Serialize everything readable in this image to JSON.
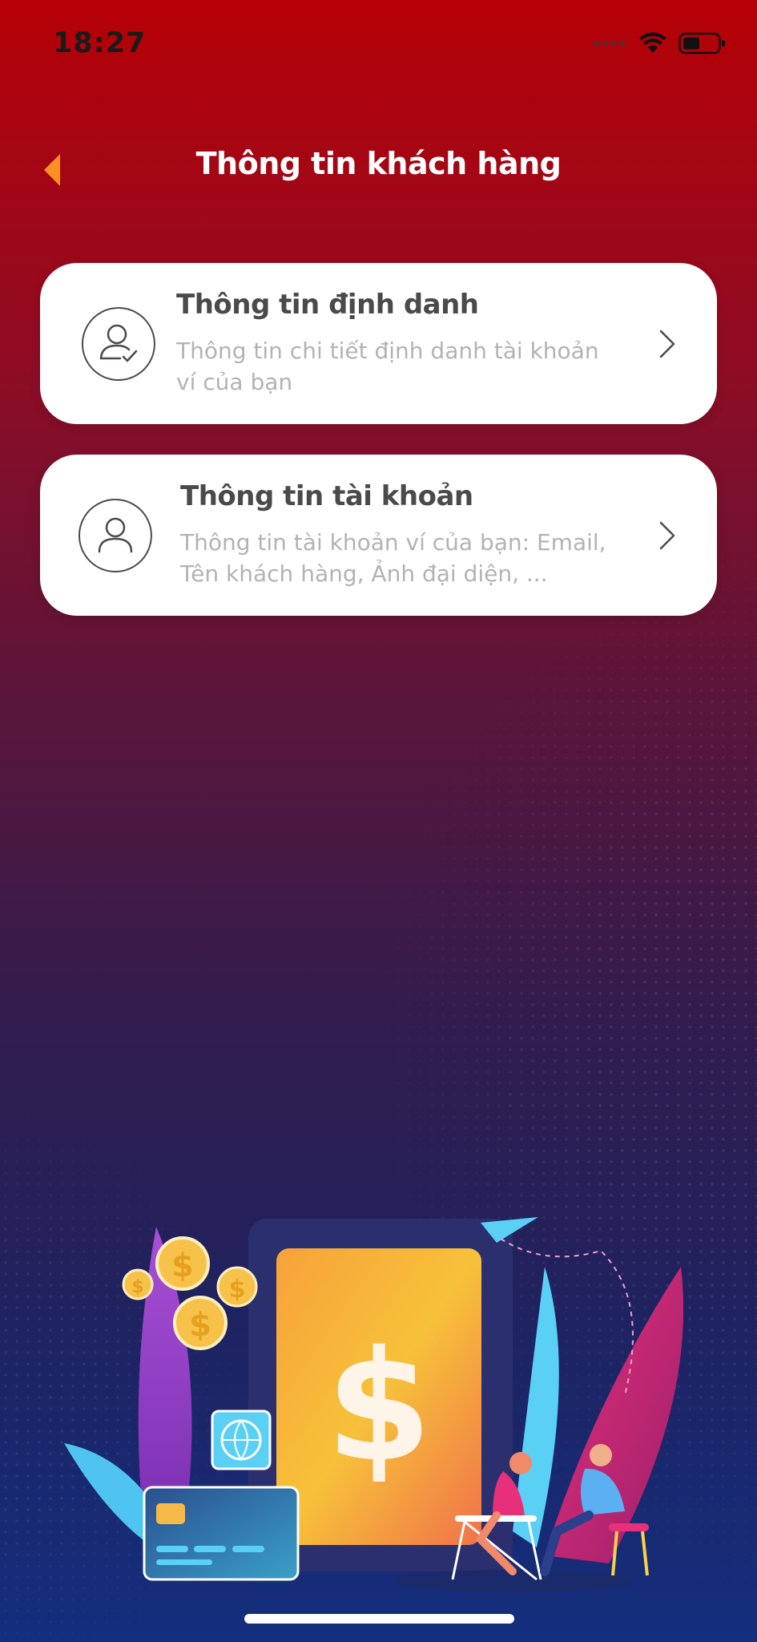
{
  "status_bar": {
    "time": "18:27"
  },
  "header": {
    "title": "Thông tin khách hàng"
  },
  "menu": [
    {
      "title": "Thông tin định danh",
      "description": "Thông tin chi tiết định danh tài khoản ví của bạn",
      "icon": "verified-user-icon"
    },
    {
      "title": "Thông tin tài khoản",
      "description": "Thông tin tài khoản ví của bạn: Email, Tên khách hàng, Ảnh đại diện, ...",
      "icon": "user-icon"
    }
  ],
  "colors": {
    "accent": "#f7931e",
    "card_background": "#ffffff",
    "title_text": "#4a4a4a",
    "description_text": "#b3b3b3"
  }
}
